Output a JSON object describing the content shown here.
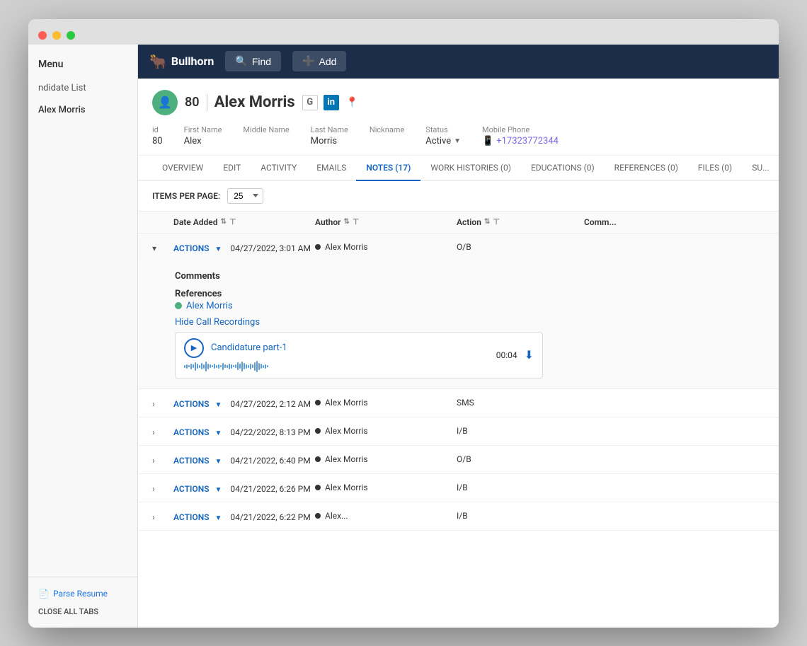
{
  "browser": {
    "dots": [
      "red",
      "yellow",
      "green"
    ]
  },
  "nav": {
    "brand": "Bullhorn",
    "find_label": "Find",
    "add_label": "Add"
  },
  "sidebar": {
    "menu_label": "Menu",
    "candidate_list": "ndidate List",
    "candidate_name": "Alex Morris",
    "parse_resume": "Parse Resume",
    "close_all": "CLOSE ALL TABS"
  },
  "candidate": {
    "id": "80",
    "name": "Alex Morris",
    "fields": {
      "id_label": "id",
      "id_value": "80",
      "first_name_label": "First Name",
      "first_name": "Alex",
      "middle_name_label": "Middle Name",
      "middle_name": "",
      "last_name_label": "Last Name",
      "last_name": "Morris",
      "nickname_label": "Nickname",
      "nickname": "",
      "status_label": "Status",
      "status": "Active",
      "mobile_label": "Mobile Phone",
      "mobile": "+17323772344"
    }
  },
  "tabs": [
    {
      "label": "OVERVIEW",
      "active": false
    },
    {
      "label": "EDIT",
      "active": false
    },
    {
      "label": "ACTIVITY",
      "active": false
    },
    {
      "label": "EMAILS",
      "active": false
    },
    {
      "label": "NOTES (17)",
      "active": true
    },
    {
      "label": "WORK HISTORIES (0)",
      "active": false
    },
    {
      "label": "EDUCATIONS (0)",
      "active": false
    },
    {
      "label": "REFERENCES (0)",
      "active": false
    },
    {
      "label": "FILES (0)",
      "active": false
    },
    {
      "label": "SU...",
      "active": false
    }
  ],
  "table": {
    "items_per_page_label": "ITEMS PER PAGE:",
    "items_per_page": "25",
    "columns": {
      "date_added": "Date Added",
      "author": "Author",
      "action": "Action",
      "comment": "Comm..."
    },
    "rows": [
      {
        "expanded": true,
        "actions_label": "ACTIONS",
        "date": "04/27/2022, 3:01 AM",
        "author": "Alex Morris",
        "action": "O/B",
        "comments_label": "Comments",
        "references_label": "References",
        "ref_name": "Alex Morris",
        "hide_recordings": "Hide Call Recordings",
        "recording_name": "Candidature part-1",
        "recording_duration": "00:04"
      },
      {
        "expanded": false,
        "actions_label": "ACTIONS",
        "date": "04/27/2022, 2:12 AM",
        "author": "Alex Morris",
        "action": "SMS"
      },
      {
        "expanded": false,
        "actions_label": "ACTIONS",
        "date": "04/22/2022, 8:13 PM",
        "author": "Alex Morris",
        "action": "I/B"
      },
      {
        "expanded": false,
        "actions_label": "ACTIONS",
        "date": "04/21/2022, 6:40 PM",
        "author": "Alex Morris",
        "action": "O/B"
      },
      {
        "expanded": false,
        "actions_label": "ACTIONS",
        "date": "04/21/2022, 6:26 PM",
        "author": "Alex Morris",
        "action": "I/B"
      },
      {
        "expanded": false,
        "actions_label": "ACTIONS",
        "date": "04/21/2022, 6:22 PM",
        "author": "Alex...",
        "action": "I/B"
      }
    ]
  }
}
